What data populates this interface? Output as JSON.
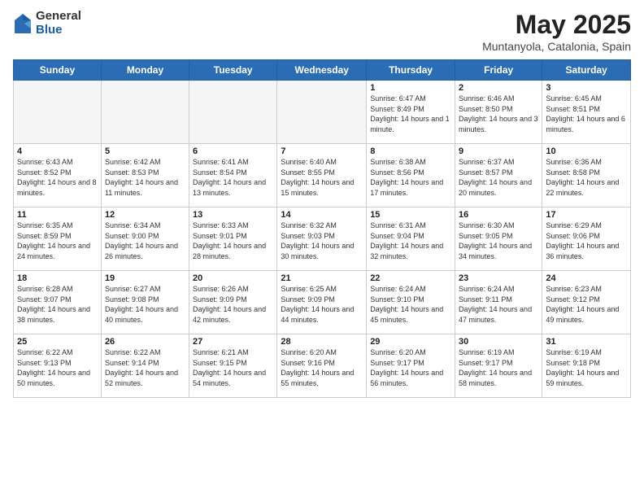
{
  "logo": {
    "general": "General",
    "blue": "Blue"
  },
  "title": "May 2025",
  "subtitle": "Muntanyola, Catalonia, Spain",
  "days_header": [
    "Sunday",
    "Monday",
    "Tuesday",
    "Wednesday",
    "Thursday",
    "Friday",
    "Saturday"
  ],
  "weeks": [
    [
      {
        "day": "",
        "sunrise": "",
        "sunset": "",
        "daylight": ""
      },
      {
        "day": "",
        "sunrise": "",
        "sunset": "",
        "daylight": ""
      },
      {
        "day": "",
        "sunrise": "",
        "sunset": "",
        "daylight": ""
      },
      {
        "day": "",
        "sunrise": "",
        "sunset": "",
        "daylight": ""
      },
      {
        "day": "1",
        "sunrise": "Sunrise: 6:47 AM",
        "sunset": "Sunset: 8:49 PM",
        "daylight": "Daylight: 14 hours and 1 minute."
      },
      {
        "day": "2",
        "sunrise": "Sunrise: 6:46 AM",
        "sunset": "Sunset: 8:50 PM",
        "daylight": "Daylight: 14 hours and 3 minutes."
      },
      {
        "day": "3",
        "sunrise": "Sunrise: 6:45 AM",
        "sunset": "Sunset: 8:51 PM",
        "daylight": "Daylight: 14 hours and 6 minutes."
      }
    ],
    [
      {
        "day": "4",
        "sunrise": "Sunrise: 6:43 AM",
        "sunset": "Sunset: 8:52 PM",
        "daylight": "Daylight: 14 hours and 8 minutes."
      },
      {
        "day": "5",
        "sunrise": "Sunrise: 6:42 AM",
        "sunset": "Sunset: 8:53 PM",
        "daylight": "Daylight: 14 hours and 11 minutes."
      },
      {
        "day": "6",
        "sunrise": "Sunrise: 6:41 AM",
        "sunset": "Sunset: 8:54 PM",
        "daylight": "Daylight: 14 hours and 13 minutes."
      },
      {
        "day": "7",
        "sunrise": "Sunrise: 6:40 AM",
        "sunset": "Sunset: 8:55 PM",
        "daylight": "Daylight: 14 hours and 15 minutes."
      },
      {
        "day": "8",
        "sunrise": "Sunrise: 6:38 AM",
        "sunset": "Sunset: 8:56 PM",
        "daylight": "Daylight: 14 hours and 17 minutes."
      },
      {
        "day": "9",
        "sunrise": "Sunrise: 6:37 AM",
        "sunset": "Sunset: 8:57 PM",
        "daylight": "Daylight: 14 hours and 20 minutes."
      },
      {
        "day": "10",
        "sunrise": "Sunrise: 6:36 AM",
        "sunset": "Sunset: 8:58 PM",
        "daylight": "Daylight: 14 hours and 22 minutes."
      }
    ],
    [
      {
        "day": "11",
        "sunrise": "Sunrise: 6:35 AM",
        "sunset": "Sunset: 8:59 PM",
        "daylight": "Daylight: 14 hours and 24 minutes."
      },
      {
        "day": "12",
        "sunrise": "Sunrise: 6:34 AM",
        "sunset": "Sunset: 9:00 PM",
        "daylight": "Daylight: 14 hours and 26 minutes."
      },
      {
        "day": "13",
        "sunrise": "Sunrise: 6:33 AM",
        "sunset": "Sunset: 9:01 PM",
        "daylight": "Daylight: 14 hours and 28 minutes."
      },
      {
        "day": "14",
        "sunrise": "Sunrise: 6:32 AM",
        "sunset": "Sunset: 9:03 PM",
        "daylight": "Daylight: 14 hours and 30 minutes."
      },
      {
        "day": "15",
        "sunrise": "Sunrise: 6:31 AM",
        "sunset": "Sunset: 9:04 PM",
        "daylight": "Daylight: 14 hours and 32 minutes."
      },
      {
        "day": "16",
        "sunrise": "Sunrise: 6:30 AM",
        "sunset": "Sunset: 9:05 PM",
        "daylight": "Daylight: 14 hours and 34 minutes."
      },
      {
        "day": "17",
        "sunrise": "Sunrise: 6:29 AM",
        "sunset": "Sunset: 9:06 PM",
        "daylight": "Daylight: 14 hours and 36 minutes."
      }
    ],
    [
      {
        "day": "18",
        "sunrise": "Sunrise: 6:28 AM",
        "sunset": "Sunset: 9:07 PM",
        "daylight": "Daylight: 14 hours and 38 minutes."
      },
      {
        "day": "19",
        "sunrise": "Sunrise: 6:27 AM",
        "sunset": "Sunset: 9:08 PM",
        "daylight": "Daylight: 14 hours and 40 minutes."
      },
      {
        "day": "20",
        "sunrise": "Sunrise: 6:26 AM",
        "sunset": "Sunset: 9:09 PM",
        "daylight": "Daylight: 14 hours and 42 minutes."
      },
      {
        "day": "21",
        "sunrise": "Sunrise: 6:25 AM",
        "sunset": "Sunset: 9:09 PM",
        "daylight": "Daylight: 14 hours and 44 minutes."
      },
      {
        "day": "22",
        "sunrise": "Sunrise: 6:24 AM",
        "sunset": "Sunset: 9:10 PM",
        "daylight": "Daylight: 14 hours and 45 minutes."
      },
      {
        "day": "23",
        "sunrise": "Sunrise: 6:24 AM",
        "sunset": "Sunset: 9:11 PM",
        "daylight": "Daylight: 14 hours and 47 minutes."
      },
      {
        "day": "24",
        "sunrise": "Sunrise: 6:23 AM",
        "sunset": "Sunset: 9:12 PM",
        "daylight": "Daylight: 14 hours and 49 minutes."
      }
    ],
    [
      {
        "day": "25",
        "sunrise": "Sunrise: 6:22 AM",
        "sunset": "Sunset: 9:13 PM",
        "daylight": "Daylight: 14 hours and 50 minutes."
      },
      {
        "day": "26",
        "sunrise": "Sunrise: 6:22 AM",
        "sunset": "Sunset: 9:14 PM",
        "daylight": "Daylight: 14 hours and 52 minutes."
      },
      {
        "day": "27",
        "sunrise": "Sunrise: 6:21 AM",
        "sunset": "Sunset: 9:15 PM",
        "daylight": "Daylight: 14 hours and 54 minutes."
      },
      {
        "day": "28",
        "sunrise": "Sunrise: 6:20 AM",
        "sunset": "Sunset: 9:16 PM",
        "daylight": "Daylight: 14 hours and 55 minutes."
      },
      {
        "day": "29",
        "sunrise": "Sunrise: 6:20 AM",
        "sunset": "Sunset: 9:17 PM",
        "daylight": "Daylight: 14 hours and 56 minutes."
      },
      {
        "day": "30",
        "sunrise": "Sunrise: 6:19 AM",
        "sunset": "Sunset: 9:17 PM",
        "daylight": "Daylight: 14 hours and 58 minutes."
      },
      {
        "day": "31",
        "sunrise": "Sunrise: 6:19 AM",
        "sunset": "Sunset: 9:18 PM",
        "daylight": "Daylight: 14 hours and 59 minutes."
      }
    ]
  ]
}
